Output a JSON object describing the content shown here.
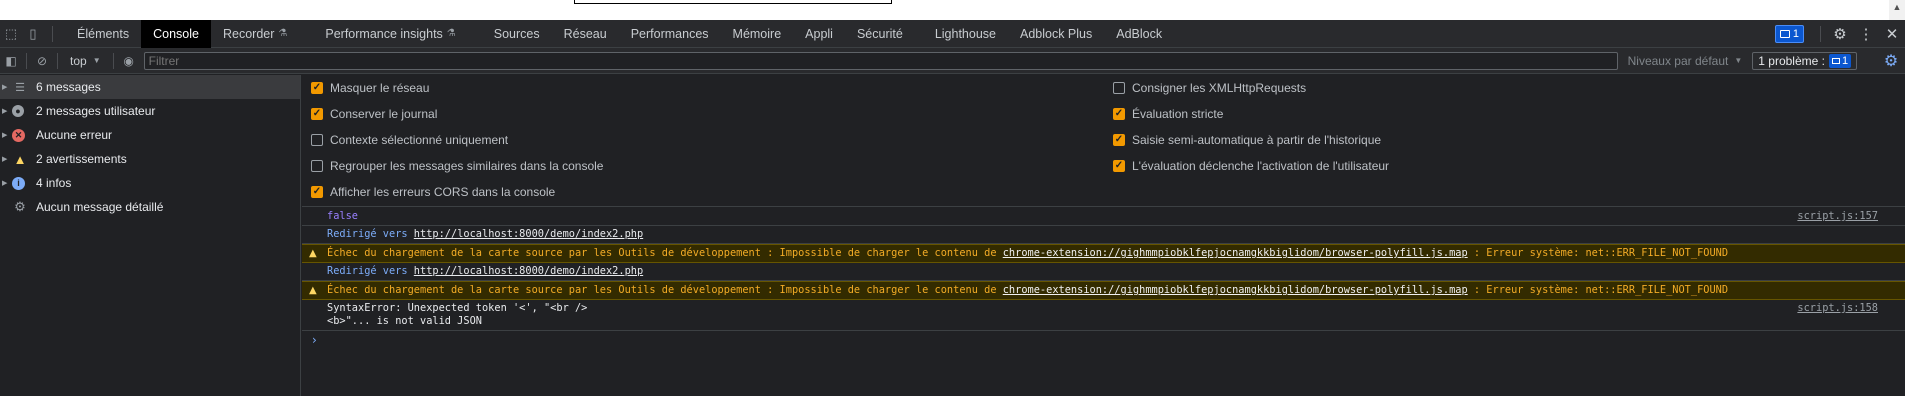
{
  "tabs": [
    {
      "label": "Éléments"
    },
    {
      "label": "Console",
      "active": true
    },
    {
      "label": "Recorder",
      "flask": true
    },
    {
      "label": "Performance insights",
      "flask": true
    },
    {
      "label": "Sources"
    },
    {
      "label": "Réseau"
    },
    {
      "label": "Performances"
    },
    {
      "label": "Mémoire"
    },
    {
      "label": "Appli"
    },
    {
      "label": "Sécurité"
    },
    {
      "label": "Lighthouse"
    },
    {
      "label": "Adblock Plus"
    },
    {
      "label": "AdBlock"
    }
  ],
  "tabbar": {
    "issues_badge_count": "1",
    "icons": [
      "inspect-icon",
      "device-icon",
      "gear-icon",
      "more-vertical-icon",
      "close-icon"
    ]
  },
  "toolbar": {
    "context": "top",
    "filter_placeholder": "Filtrer",
    "levels": "Niveaux par défaut",
    "issues_label": "1 problème :",
    "issues_count": "1"
  },
  "sidebar": {
    "items": [
      {
        "label": "6 messages",
        "icon": "list-icon"
      },
      {
        "label": "2 messages utilisateur",
        "icon": "user-icon"
      },
      {
        "label": "Aucune erreur",
        "icon": "error-icon"
      },
      {
        "label": "2 avertissements",
        "icon": "warning-icon"
      },
      {
        "label": "4 infos",
        "icon": "info-icon"
      },
      {
        "label": "Aucun message détaillé",
        "icon": "verbose-icon"
      }
    ]
  },
  "settings": {
    "left": [
      {
        "label": "Masquer le réseau",
        "checked": true
      },
      {
        "label": "Conserver le journal",
        "checked": true
      },
      {
        "label": "Contexte sélectionné uniquement",
        "checked": false
      },
      {
        "label": "Regrouper les messages similaires dans la console",
        "checked": false
      },
      {
        "label": "Afficher les erreurs CORS dans la console",
        "checked": true
      }
    ],
    "right": [
      {
        "label": "Consigner les XMLHttpRequests",
        "checked": false
      },
      {
        "label": "Évaluation stricte",
        "checked": true
      },
      {
        "label": "Saisie semi-automatique à partir de l'historique",
        "checked": true
      },
      {
        "label": "L'évaluation déclenche l'activation de l'utilisateur",
        "checked": true
      }
    ]
  },
  "console": {
    "messages": [
      {
        "type": "log",
        "value": "false",
        "source": "script.js:157"
      },
      {
        "type": "redirect",
        "prefix": "Redirigé vers",
        "url": "http://localhost:8000/demo/index2.php"
      },
      {
        "type": "warning",
        "before": "Échec du chargement de la carte source par les Outils de développement : Impossible de charger le contenu de",
        "url": "chrome-extension://gighmmpiobklfepjocnamgkkbiglidom/browser-polyfill.js.map",
        "after": ": Erreur système: net::ERR_FILE_NOT_FOUND"
      },
      {
        "type": "redirect",
        "prefix": "Redirigé vers",
        "url": "http://localhost:8000/demo/index2.php"
      },
      {
        "type": "warning",
        "before": "Échec du chargement de la carte source par les Outils de développement : Impossible de charger le contenu de",
        "url": "chrome-extension://gighmmpiobklfepjocnamgkkbiglidom/browser-polyfill.js.map",
        "after": ": Erreur système: net::ERR_FILE_NOT_FOUND"
      },
      {
        "type": "log",
        "line1": "SyntaxError: Unexpected token '<', \"<br />",
        "line2": "<b>\"... is not valid JSON",
        "source": "script.js:158"
      }
    ]
  },
  "colors": {
    "accent_blue": "#7cacf8",
    "warning_text": "#f2ab26",
    "checkbox_on": "#f29900"
  }
}
